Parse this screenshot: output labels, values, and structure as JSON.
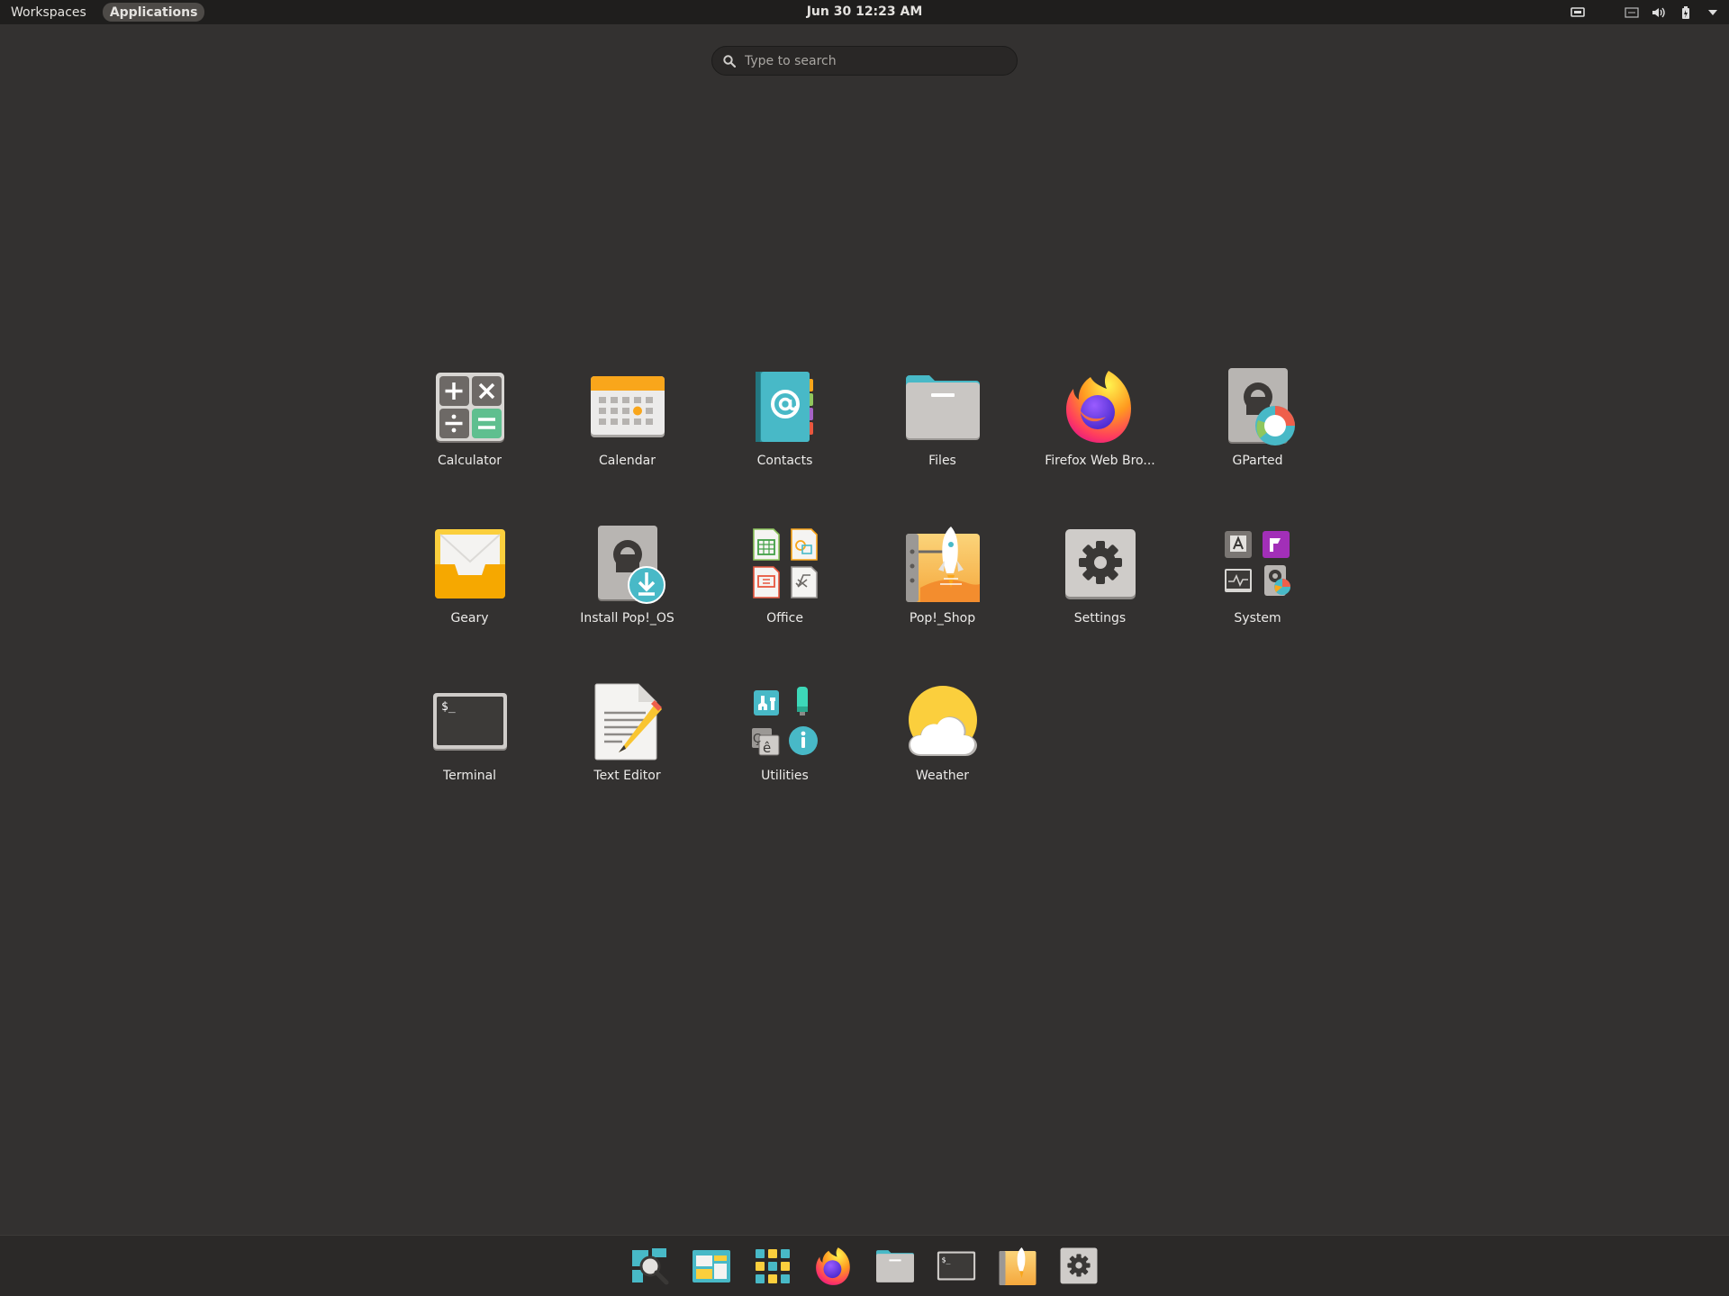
{
  "topbar": {
    "workspaces": "Workspaces",
    "applications": "Applications",
    "clock": "Jun 30  12:23 AM"
  },
  "search": {
    "placeholder": "Type to search"
  },
  "apps": [
    {
      "label": "Calculator",
      "icon": "calculator-icon"
    },
    {
      "label": "Calendar",
      "icon": "calendar-icon"
    },
    {
      "label": "Contacts",
      "icon": "contacts-icon"
    },
    {
      "label": "Files",
      "icon": "files-icon"
    },
    {
      "label": "Firefox Web Bro...",
      "icon": "firefox-icon"
    },
    {
      "label": "GParted",
      "icon": "gparted-icon"
    },
    {
      "label": "Geary",
      "icon": "geary-icon"
    },
    {
      "label": "Install Pop!_OS",
      "icon": "install-pop-os-icon"
    },
    {
      "label": "Office",
      "icon": "office-folder-icon"
    },
    {
      "label": "Pop!_Shop",
      "icon": "pop-shop-icon"
    },
    {
      "label": "Settings",
      "icon": "settings-icon"
    },
    {
      "label": "System",
      "icon": "system-folder-icon"
    },
    {
      "label": "Terminal",
      "icon": "terminal-icon"
    },
    {
      "label": "Text Editor",
      "icon": "text-editor-icon"
    },
    {
      "label": "Utilities",
      "icon": "utilities-folder-icon"
    },
    {
      "label": "Weather",
      "icon": "weather-icon"
    }
  ],
  "dock": [
    "launcher-search-icon",
    "workspaces-icon",
    "app-grid-icon",
    "firefox-icon",
    "files-icon",
    "terminal-icon",
    "pop-shop-icon",
    "settings-icon"
  ],
  "colors": {
    "background": "#333130",
    "topbar": "#1f1e1d",
    "accent_teal": "#48b9c7",
    "accent_orange": "#faa41a"
  }
}
